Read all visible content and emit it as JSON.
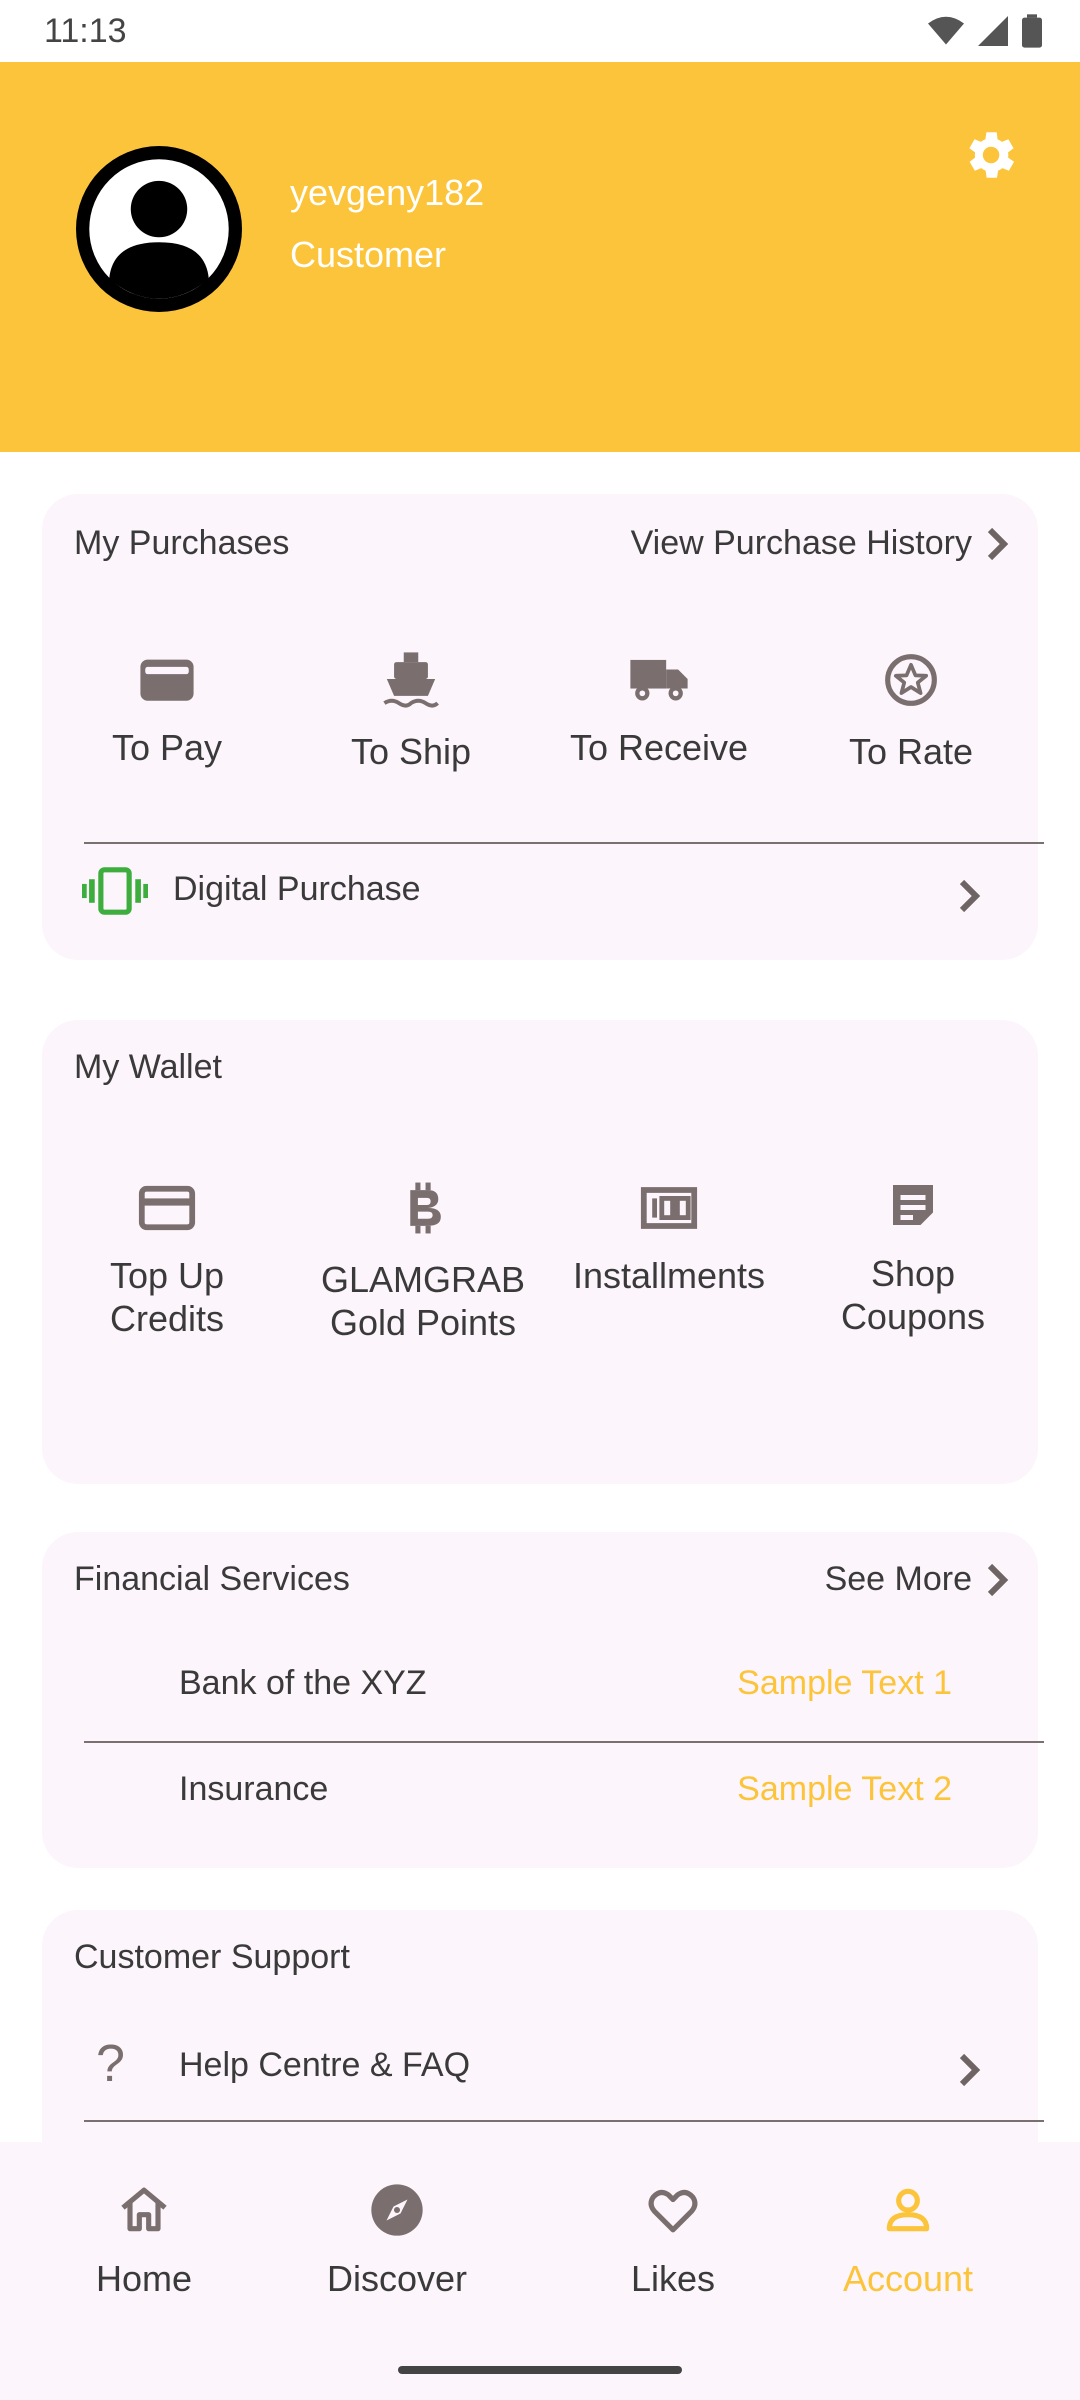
{
  "status_bar": {
    "time": "11:13"
  },
  "profile": {
    "username": "yevgeny182",
    "role": "Customer"
  },
  "purchases": {
    "title": "My Purchases",
    "history_link": "View Purchase History",
    "items": [
      {
        "label": "To Pay",
        "icon": "wallet-icon"
      },
      {
        "label": "To Ship",
        "icon": "ship-icon"
      },
      {
        "label": "To Receive",
        "icon": "truck-icon"
      },
      {
        "label": "To Rate",
        "icon": "star-circle-icon"
      }
    ],
    "digital": "Digital Purchase"
  },
  "wallet": {
    "title": "My Wallet",
    "items": [
      {
        "line1": "Top Up",
        "line2": "Credits",
        "icon": "credit-card-icon"
      },
      {
        "line1": "GLAMGRAB",
        "line2": "Gold Points",
        "icon": "bitcoin-icon"
      },
      {
        "line1": "Installments",
        "line2": "",
        "icon": "money-icon"
      },
      {
        "line1": "Shop",
        "line2": "Coupons",
        "icon": "coupon-icon"
      }
    ]
  },
  "financial": {
    "title": "Financial Services",
    "see_more": "See More",
    "rows": [
      {
        "label": "Bank of the XYZ",
        "value": "Sample Text 1"
      },
      {
        "label": "Insurance",
        "value": "Sample Text 2"
      }
    ]
  },
  "support": {
    "title": "Customer Support",
    "help": "Help Centre & FAQ"
  },
  "nav": {
    "items": [
      {
        "label": "Home",
        "icon": "home-icon"
      },
      {
        "label": "Discover",
        "icon": "compass-icon"
      },
      {
        "label": "Likes",
        "icon": "heart-icon"
      },
      {
        "label": "Account",
        "icon": "account-icon"
      }
    ],
    "active": "Account"
  },
  "colors": {
    "accent": "#FCC43A",
    "card_bg": "#FCF5FB",
    "icon_gray": "#7A6E6E",
    "green": "#3DAE3D"
  }
}
